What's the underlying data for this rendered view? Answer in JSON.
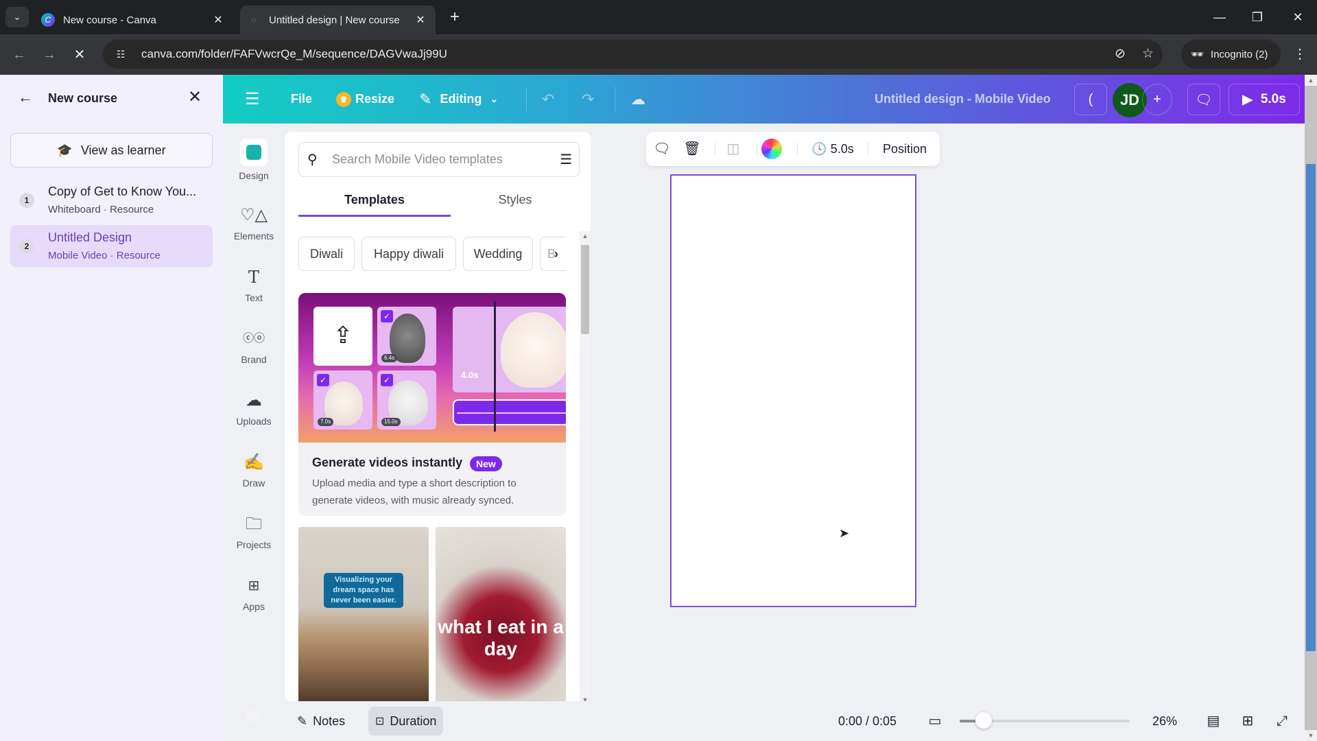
{
  "browser": {
    "tabs": [
      {
        "title": "New course - Canva",
        "favicon": "canva-logo-icon",
        "active": false
      },
      {
        "title": "Untitled design | New course",
        "favicon": "loading-icon",
        "active": true
      }
    ],
    "new_tab_label": "+",
    "url": "canva.com/folder/FAFVwcrQe_M/sequence/DAGVwaJj99U",
    "profile_label": "Incognito (2)"
  },
  "course_panel": {
    "title": "New course",
    "view_as_learner_label": "View as learner",
    "items": [
      {
        "index": "1",
        "title": "Copy of Get to Know You...",
        "subtitle": "Whiteboard · Resource",
        "active": false
      },
      {
        "index": "2",
        "title": "Untitled Design",
        "subtitle": "Mobile Video · Resource",
        "active": true
      }
    ]
  },
  "editor_header": {
    "file_label": "File",
    "resize_label": "Resize",
    "mode_label": "Editing",
    "design_title": "Untitled design - Mobile Video",
    "avatar_initials": "JD",
    "play_label": "5.0s"
  },
  "rail": {
    "items": [
      {
        "label": "Design",
        "icon": "design-icon",
        "active": true
      },
      {
        "label": "Elements",
        "icon": "elements-icon"
      },
      {
        "label": "Text",
        "icon": "text-icon"
      },
      {
        "label": "Brand",
        "icon": "brand-icon"
      },
      {
        "label": "Uploads",
        "icon": "uploads-icon"
      },
      {
        "label": "Draw",
        "icon": "draw-icon"
      },
      {
        "label": "Projects",
        "icon": "projects-icon"
      },
      {
        "label": "Apps",
        "icon": "apps-icon"
      }
    ]
  },
  "templates_panel": {
    "search_placeholder": "Search Mobile Video templates",
    "search_value": "",
    "tabs": [
      {
        "label": "Templates",
        "active": true
      },
      {
        "label": "Styles",
        "active": false
      }
    ],
    "chips": [
      "Diwali",
      "Happy diwali",
      "Wedding",
      "B"
    ],
    "promo": {
      "title": "Generate videos instantly",
      "badge": "New",
      "description": "Upload media and type a short description to generate videos, with music already synced.",
      "durations": [
        "6.4s",
        "7.0s",
        "15.0s",
        "4.0s"
      ]
    },
    "template_thumbs": [
      {
        "caption": "Visualizing your dream space has never been easier."
      },
      {
        "caption": "what I eat in a day"
      }
    ]
  },
  "canvas_toolbar": {
    "duration_label": "5.0s",
    "position_label": "Position"
  },
  "bottom_bar": {
    "notes_label": "Notes",
    "duration_label": "Duration",
    "timecode": "0:00 / 0:05",
    "zoom_label": "26%",
    "zoom_percent": 26
  },
  "colors": {
    "accent_purple": "#7d2ae8",
    "header_gradient_start": "#12cdc3",
    "header_gradient_end": "#7d2ae8",
    "avatar_bg": "#0e5a1c",
    "active_item_bg": "#e6dcfa"
  }
}
